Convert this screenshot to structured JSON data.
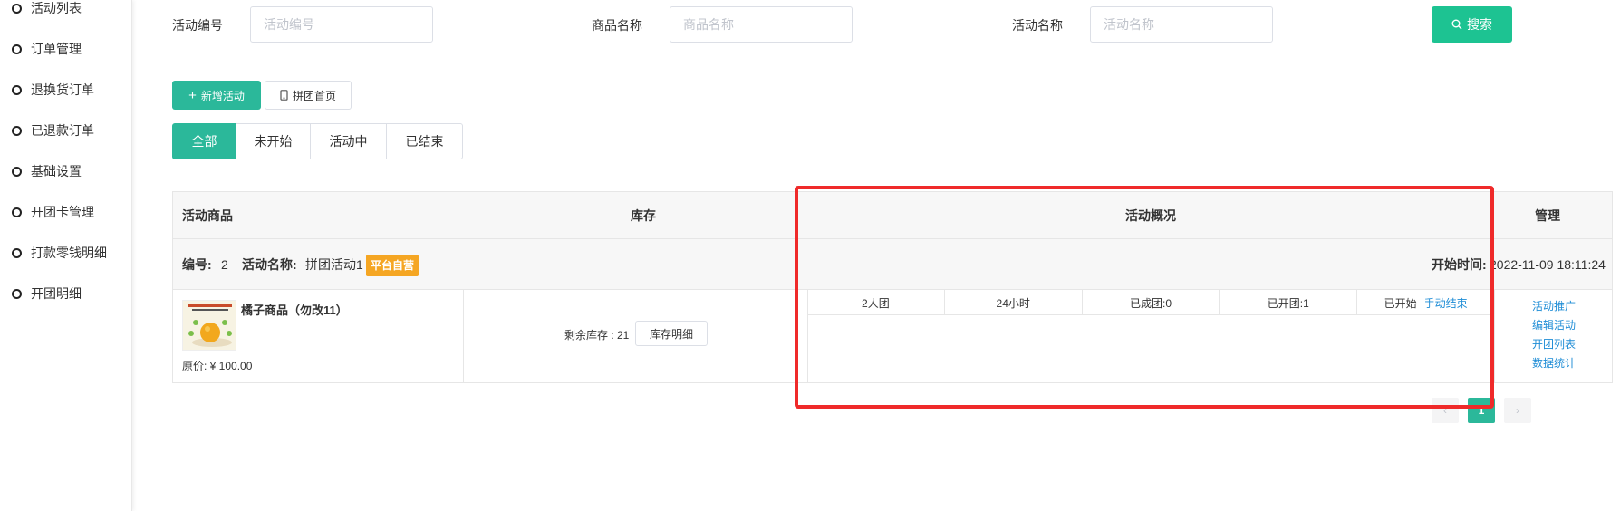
{
  "sidebar": {
    "items": [
      {
        "label": "活动列表"
      },
      {
        "label": "订单管理"
      },
      {
        "label": "退换货订单"
      },
      {
        "label": "已退款订单"
      },
      {
        "label": "基础设置"
      },
      {
        "label": "开团卡管理"
      },
      {
        "label": "打款零钱明细"
      },
      {
        "label": "开团明细"
      }
    ]
  },
  "filters": {
    "activity_id": {
      "label": "活动编号",
      "placeholder": "活动编号",
      "value": ""
    },
    "product_name": {
      "label": "商品名称",
      "placeholder": "商品名称",
      "value": ""
    },
    "activity_name": {
      "label": "活动名称",
      "placeholder": "活动名称",
      "value": ""
    },
    "search_label": "搜索"
  },
  "actions": {
    "add_label": "新增活动",
    "home_label": "拼团首页"
  },
  "tabs": [
    {
      "label": "全部",
      "active": true
    },
    {
      "label": "未开始",
      "active": false
    },
    {
      "label": "活动中",
      "active": false
    },
    {
      "label": "已结束",
      "active": false
    }
  ],
  "table": {
    "headers": {
      "product": "活动商品",
      "stock": "库存",
      "overview": "活动概况",
      "manage": "管理"
    },
    "group": {
      "id_label": "编号:",
      "id_value": "2",
      "name_label": "活动名称:",
      "name_value": "拼团活动1",
      "badge": "平台自营",
      "start_label": "开始时间:",
      "start_value": "2022-11-09 18:11:24"
    },
    "row": {
      "product_name": "橘子商品（勿改11）",
      "price": "原价: ¥ 100.00",
      "stock_text": "剩余库存 : 21",
      "stock_button": "库存明细",
      "overview": {
        "team_size": "2人团",
        "duration": "24小时",
        "formed": "已成团:0",
        "opened": "已开团:1",
        "status": "已开始",
        "end_action": "手动结束"
      },
      "manage": {
        "promote": "活动推广",
        "edit": "编辑活动",
        "group_list": "开团列表",
        "stats": "数据统计"
      }
    }
  },
  "pagination": {
    "prev": "‹",
    "current": "1",
    "next": "›"
  },
  "colors": {
    "primary": "#2bb89a",
    "search": "#1dc392",
    "badge": "#f5a623",
    "link": "#1f8dd6",
    "annotation": "#ef2a2a"
  }
}
